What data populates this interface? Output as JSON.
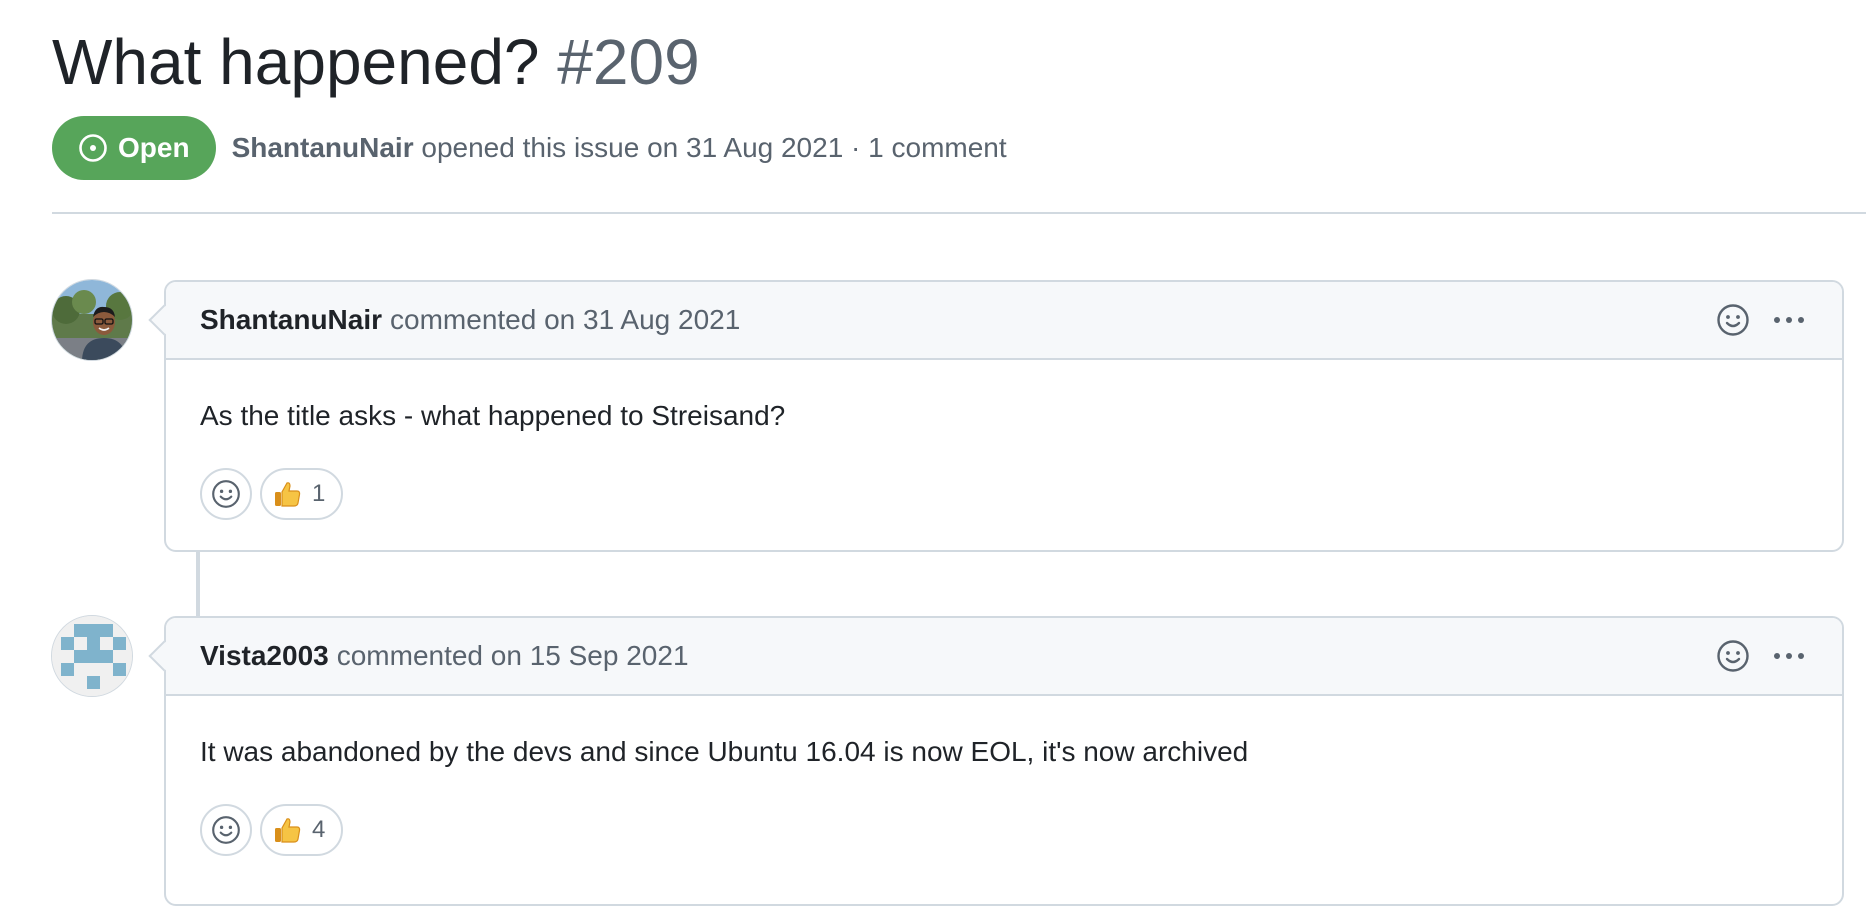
{
  "issue": {
    "title": "What happened?",
    "number": "#209",
    "state": "Open",
    "state_color": "#57a55a",
    "author": "ShantanuNair",
    "meta": "opened this issue on 31 Aug 2021 · 1 comment"
  },
  "comments": [
    {
      "author": "ShantanuNair",
      "action": "commented on 31 Aug 2021",
      "avatar": "photo-avatar",
      "body": "As the title asks - what happened to Streisand?",
      "reaction_emoji": "thumbs-up",
      "reaction_count": "1"
    },
    {
      "author": "Vista2003",
      "action": "commented on 15 Sep 2021",
      "avatar": "identicon-avatar",
      "identicon_color": "#7fb3cc",
      "body": "It was abandoned by the devs and since Ubuntu 16.04 is now EOL, it's now archived",
      "reaction_emoji": "thumbs-up",
      "reaction_count": "4"
    }
  ],
  "icons": {
    "state": "issue-opened-icon",
    "add_reaction": "smiley-icon",
    "more": "kebab-horizontal-icon"
  },
  "colors": {
    "text_primary": "#1f2328",
    "text_muted": "#59636e",
    "border": "#d1d9e0",
    "header_bg": "#f6f8fa"
  }
}
